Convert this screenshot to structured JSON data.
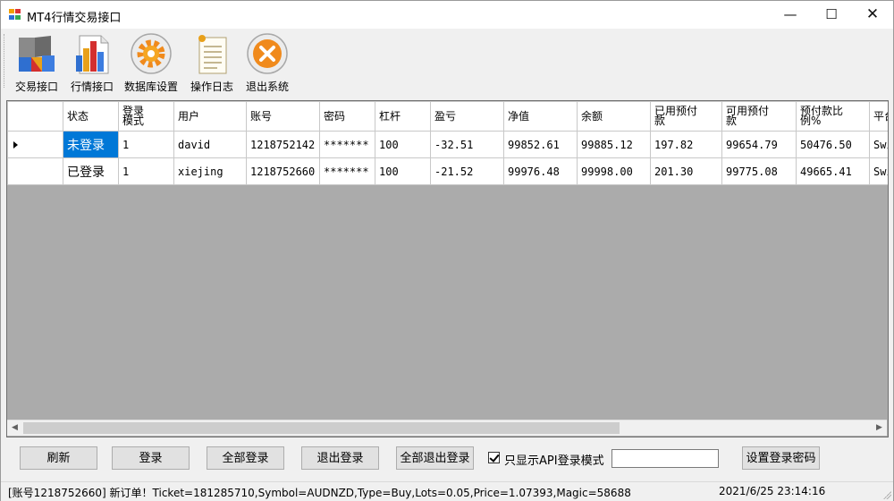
{
  "window": {
    "title": "MT4行情交易接口",
    "minimize_glyph": "—",
    "maximize_glyph": "☐",
    "close_glyph": "✕"
  },
  "toolbar": {
    "items": [
      {
        "label": "交易接口",
        "icon": "trading-interface-icon"
      },
      {
        "label": "行情接口",
        "icon": "market-chart-icon"
      },
      {
        "label": "数据库设置",
        "icon": "database-gear-icon"
      },
      {
        "label": "操作日志",
        "icon": "log-document-icon"
      },
      {
        "label": "退出系统",
        "icon": "exit-icon"
      }
    ]
  },
  "grid": {
    "columns": [
      "状态",
      "登录模式",
      "用户",
      "账号",
      "密码",
      "杠杆",
      "盈亏",
      "净值",
      "余额",
      "已用预付款",
      "可用预付款",
      "预付款比例%",
      "平台"
    ],
    "rows": [
      {
        "current": true,
        "cells": [
          "未登录",
          "1",
          "david",
          "1218752142",
          "*******",
          "100",
          "-32.51",
          "99852.61",
          "99885.12",
          "197.82",
          "99654.79",
          "50476.50",
          "Swi"
        ]
      },
      {
        "current": false,
        "cells": [
          "已登录",
          "1",
          "xiejing",
          "1218752660",
          "*******",
          "100",
          "-21.52",
          "99976.48",
          "99998.00",
          "201.30",
          "99775.08",
          "49665.41",
          "Swi"
        ]
      }
    ]
  },
  "buttons": {
    "refresh": "刷新",
    "login": "登录",
    "login_all": "全部登录",
    "logout": "退出登录",
    "logout_all": "全部退出登录",
    "set_password": "设置登录密码"
  },
  "api_filter": {
    "label": "只显示API登录模式",
    "checked": true
  },
  "password_input": {
    "value": ""
  },
  "status": {
    "message": "[账号1218752660] 新订单！Ticket=181285710,Symbol=AUDNZD,Type=Buy,Lots=0.05,Price=1.07393,Magic=58688",
    "timestamp": "2021/6/25 23:14:16"
  },
  "colors": {
    "selection": "#0078d7",
    "grid_background": "#ababab"
  }
}
